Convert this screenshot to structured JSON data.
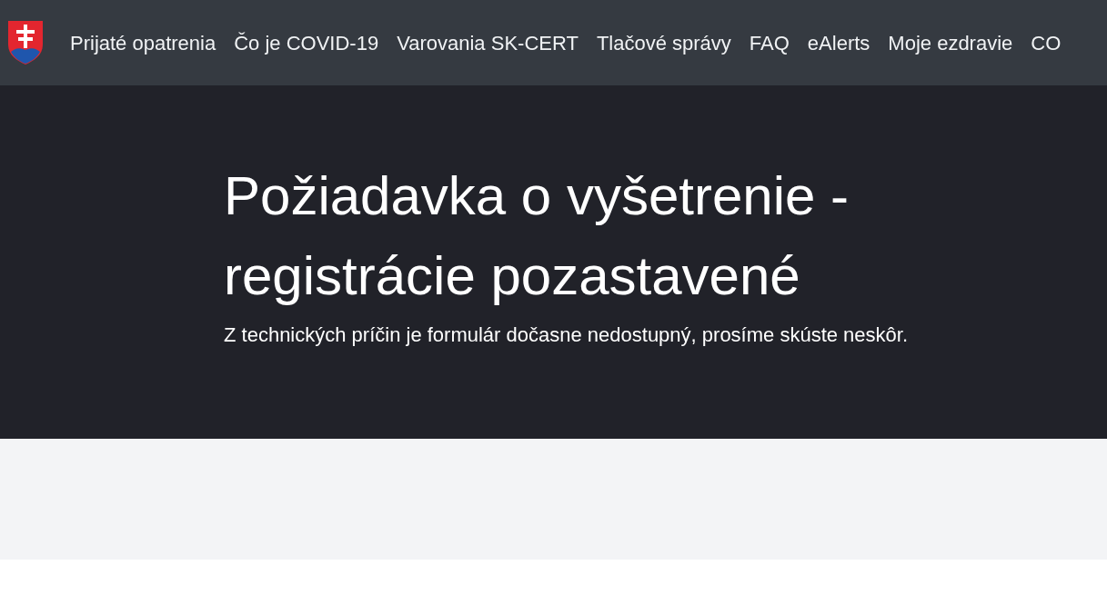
{
  "nav": {
    "items": [
      {
        "label": "Prijaté opatrenia"
      },
      {
        "label": "Čo je COVID-19"
      },
      {
        "label": "Varovania SK-CERT"
      },
      {
        "label": "Tlačové správy"
      },
      {
        "label": "FAQ"
      },
      {
        "label": "eAlerts"
      },
      {
        "label": "Moje ezdravie"
      },
      {
        "label": "CO"
      }
    ]
  },
  "hero": {
    "title": "Požiadavka o vyšetrenie - registrácie pozastavené",
    "subtitle": "Z technických príčin je formulár dočasne nedostupný, prosíme skúste neskôr."
  }
}
